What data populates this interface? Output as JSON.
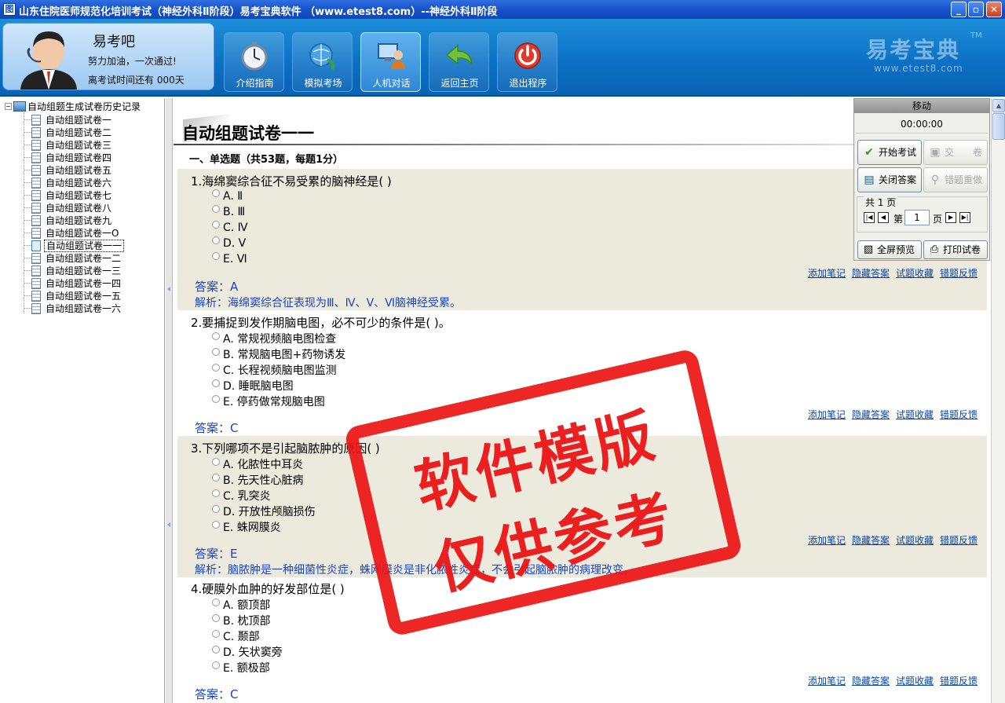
{
  "window": {
    "title": "山东住院医师规范化培训考试（神经外科Ⅱ阶段）易考宝典软件      （www.etest8.com）--神经外科Ⅱ阶段",
    "min": "_",
    "max": "▫",
    "close": "✕"
  },
  "profile": {
    "name": "易考吧",
    "motto": "努力加油，一次通过!",
    "countdown": "离考试时间还有 000天"
  },
  "nav": [
    {
      "label": "介绍指南",
      "icon": "stopwatch-icon"
    },
    {
      "label": "模拟考场",
      "icon": "globe-refresh-icon"
    },
    {
      "label": "人机对话",
      "icon": "computer-user-icon"
    },
    {
      "label": "返回主页",
      "icon": "return-arrow-icon"
    },
    {
      "label": "退出程序",
      "icon": "power-icon"
    }
  ],
  "brand": {
    "name": "易考宝典",
    "tm": "TM",
    "url": "www.etest8.com"
  },
  "tree": {
    "root": "自动组题生成试卷历史记录",
    "items": [
      "自动组题试卷一",
      "自动组题试卷二",
      "自动组题试卷三",
      "自动组题试卷四",
      "自动组题试卷五",
      "自动组题试卷六",
      "自动组题试卷七",
      "自动组题试卷八",
      "自动组题试卷九",
      "自动组题试卷一O",
      "自动组题试卷一一",
      "自动组题试卷一二",
      "自动组题试卷一三",
      "自动组题试卷一四",
      "自动组题试卷一五",
      "自动组题试卷一六"
    ],
    "selected_index": 10
  },
  "paper": {
    "title": "自动组题试卷一一",
    "section": "一、单选题（共53题，每题1分）"
  },
  "links": [
    "添加笔记",
    "隐藏答案",
    "试题收藏",
    "错题反馈"
  ],
  "questions": [
    {
      "stem": "1.海绵窦综合征不易受累的脑神经是( )",
      "options": [
        "A. Ⅱ",
        "B. Ⅲ",
        "C. Ⅳ",
        "D. Ⅴ",
        "E. Ⅵ"
      ],
      "answer": "答案：A",
      "analysis": "解析：海绵窦综合征表现为Ⅲ、Ⅳ、Ⅴ、Ⅵ脑神经受累。"
    },
    {
      "stem": "2.要捕捉到发作期脑电图，必不可少的条件是( )。",
      "options": [
        "A. 常规视频脑电图检查",
        "B. 常规脑电图+药物诱发",
        "C. 长程视频脑电图监测",
        "D. 睡眠脑电图",
        "E. 停药做常规脑电图"
      ],
      "answer": "答案：C",
      "analysis": ""
    },
    {
      "stem": "3.下列哪项不是引起脑脓肿的原因( )",
      "options": [
        "A. 化脓性中耳炎",
        "B. 先天性心脏病",
        "C. 乳突炎",
        "D. 开放性颅脑损伤",
        "E. 蛛网膜炎"
      ],
      "answer": "答案：E",
      "analysis": "解析：脑脓肿是一种细菌性炎症，蛛网膜炎是非化脓性炎症，不会引起脑脓肿的病理改变。"
    },
    {
      "stem": "4.硬膜外血肿的好发部位是( )",
      "options": [
        "A. 额顶部",
        "B. 枕顶部",
        "C. 颞部",
        "D. 矢状窦旁",
        "E. 额极部"
      ],
      "answer": "答案：C",
      "analysis": ""
    }
  ],
  "panel": {
    "title": "移动",
    "timer": "00:00:00",
    "start": "开始考试",
    "submit": "交　　卷",
    "close_answer": "关闭答案",
    "redo_wrong": "错题重做",
    "total_pages": "共 1 页",
    "page_prefix": "第",
    "page_value": "1",
    "page_suffix": "页",
    "fullscreen": "全屏预览",
    "print": "打印试卷"
  },
  "stamp": {
    "line1": "软件模版",
    "line2": "仅供参考"
  },
  "colors": {
    "accent": "#0b6fc4",
    "answer": "#1a45c8",
    "stamp": "#eb1414",
    "shaded": "#ece9dd"
  }
}
